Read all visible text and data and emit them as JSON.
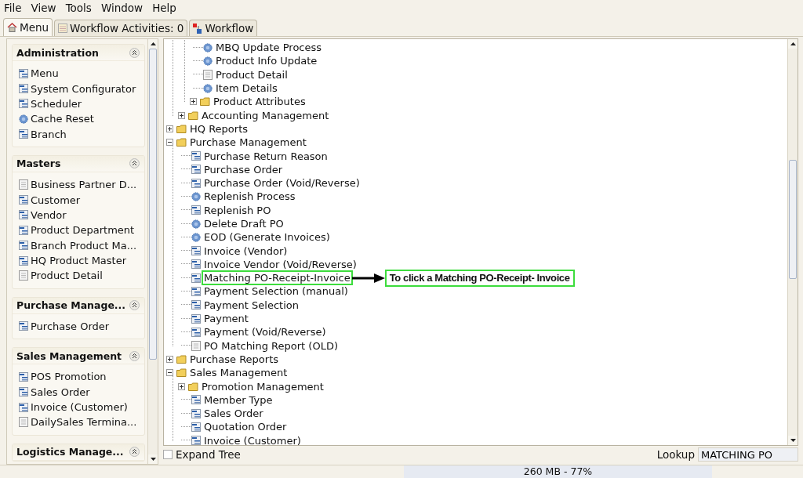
{
  "menu_bar": [
    "File",
    "View",
    "Tools",
    "Window",
    "Help"
  ],
  "tabs": [
    {
      "label": "Menu",
      "kind": "home",
      "selected": true
    },
    {
      "label": "Workflow Activities: 0",
      "kind": "list",
      "selected": false
    },
    {
      "label": "Workflow",
      "kind": "flow",
      "selected": false
    }
  ],
  "sidebar": {
    "sections": [
      {
        "title": "Administration",
        "items": [
          {
            "label": "Menu",
            "kind": "window"
          },
          {
            "label": "System Configurator",
            "kind": "window"
          },
          {
            "label": "Scheduler",
            "kind": "window"
          },
          {
            "label": "Cache Reset",
            "kind": "process"
          },
          {
            "label": "Branch",
            "kind": "window"
          }
        ]
      },
      {
        "title": "Masters",
        "items": [
          {
            "label": "Business Partner D...",
            "kind": "report"
          },
          {
            "label": "Customer",
            "kind": "window"
          },
          {
            "label": "Vendor",
            "kind": "window"
          },
          {
            "label": "Product Department",
            "kind": "window"
          },
          {
            "label": "Branch Product Ma...",
            "kind": "window"
          },
          {
            "label": "HQ Product Master",
            "kind": "window"
          },
          {
            "label": "Product Detail",
            "kind": "report"
          }
        ]
      },
      {
        "title": "Purchase Manage...",
        "items": [
          {
            "label": "Purchase Order",
            "kind": "window"
          }
        ]
      },
      {
        "title": "Sales Management",
        "items": [
          {
            "label": "POS Promotion",
            "kind": "window"
          },
          {
            "label": "Sales Order",
            "kind": "window"
          },
          {
            "label": "Invoice (Customer)",
            "kind": "window"
          },
          {
            "label": "DailySales Termina...",
            "kind": "report"
          }
        ]
      },
      {
        "title": "Logistics Manage..."
      }
    ]
  },
  "tree": {
    "items": [
      {
        "children": [
          {
            "children": [
              {
                "label": "MBQ Update Process",
                "kind": "process"
              },
              {
                "label": "Product Info Update",
                "kind": "process"
              },
              {
                "label": "Product Detail",
                "kind": "report"
              },
              {
                "label": "Item Details",
                "kind": "process"
              },
              {
                "label": "Product Attributes",
                "kind": "folder",
                "expanded": false
              }
            ]
          },
          {
            "label": "Accounting Management",
            "kind": "folder",
            "expanded": false
          }
        ]
      },
      {
        "label": "HQ Reports",
        "kind": "folder",
        "expanded": false
      },
      {
        "label": "Purchase Management",
        "kind": "folder",
        "expanded": true,
        "children": [
          {
            "label": "Purchase Return Reason",
            "kind": "window"
          },
          {
            "label": "Purchase Order",
            "kind": "window"
          },
          {
            "label": "Purchase Order (Void/Reverse)",
            "kind": "window"
          },
          {
            "label": "Replenish Process",
            "kind": "process"
          },
          {
            "label": "Replenish PO",
            "kind": "window"
          },
          {
            "label": "Delete Draft PO",
            "kind": "process"
          },
          {
            "label": "EOD (Generate Invoices)",
            "kind": "process"
          },
          {
            "label": "Invoice (Vendor)",
            "kind": "window"
          },
          {
            "label": "Invoice Vendor (Void/Reverse)",
            "kind": "window"
          },
          {
            "label": "Matching PO-Receipt-Invoice",
            "kind": "window",
            "highlighted": true,
            "callout": "To click a Matching PO-Receipt- Invoice"
          },
          {
            "label": "Payment Selection (manual)",
            "kind": "window"
          },
          {
            "label": "Payment Selection",
            "kind": "window"
          },
          {
            "label": "Payment",
            "kind": "window"
          },
          {
            "label": "Payment (Void/Reverse)",
            "kind": "window"
          },
          {
            "label": "PO Matching Report (OLD)",
            "kind": "report"
          }
        ]
      },
      {
        "label": "Purchase Reports",
        "kind": "folder",
        "expanded": false
      },
      {
        "label": "Sales Management",
        "kind": "folder",
        "expanded": true,
        "children": [
          {
            "label": "Promotion Management",
            "kind": "folder",
            "expanded": false
          },
          {
            "label": "Member Type",
            "kind": "window"
          },
          {
            "label": "Sales Order",
            "kind": "window"
          },
          {
            "label": "Quotation Order",
            "kind": "window"
          },
          {
            "label": "Invoice (Customer)",
            "kind": "window"
          }
        ]
      }
    ]
  },
  "expand_tree": {
    "label": "Expand Tree",
    "checked": false
  },
  "lookup": {
    "label": "Lookup",
    "value": "MATCHING PO"
  },
  "status_bar": {
    "memory": "260 MB - 77%"
  }
}
